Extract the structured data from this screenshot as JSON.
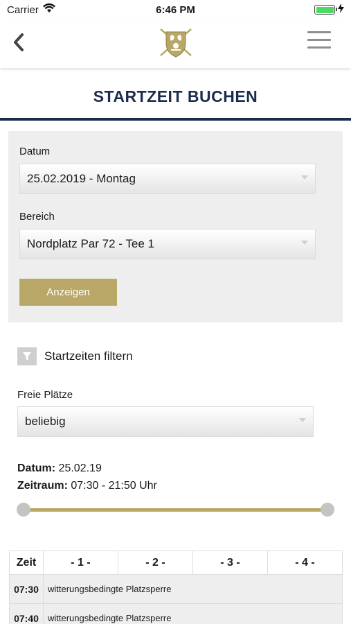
{
  "status_bar": {
    "carrier": "Carrier",
    "time": "6:46 PM",
    "battery_level": 1.0,
    "battery_color": "#4cd964"
  },
  "nav": {
    "back_icon": "chevron-left-icon",
    "logo_icon": "golf-club-crest-icon",
    "menu_icon": "hamburger-menu-icon"
  },
  "page": {
    "title": "STARTZEIT BUCHEN"
  },
  "search": {
    "date_label": "Datum",
    "date_value": "25.02.2019 - Montag",
    "area_label": "Bereich",
    "area_value": "Nordplatz Par 72 - Tee 1",
    "show_button": "Anzeigen"
  },
  "filter": {
    "icon": "funnel-icon",
    "label": "Startzeiten filtern",
    "free_places_label": "Freie Plätze",
    "free_places_value": "beliebig"
  },
  "summary": {
    "date_label": "Datum:",
    "date_value": "25.02.19",
    "range_label": "Zeitraum:",
    "range_value": "07:30 - 21:50 Uhr"
  },
  "table": {
    "headers": [
      "Zeit",
      "- 1 -",
      "- 2 -",
      "- 3 -",
      "- 4 -"
    ],
    "rows": [
      {
        "time": "07:30",
        "note": "witterungsbedingte Platzsperre"
      },
      {
        "time": "07:40",
        "note": "witterungsbedingte Platzsperre"
      }
    ]
  },
  "colors": {
    "accent_gold": "#b9a768",
    "title_navy": "#1c2c4c",
    "panel_gray": "#eeeeee"
  }
}
